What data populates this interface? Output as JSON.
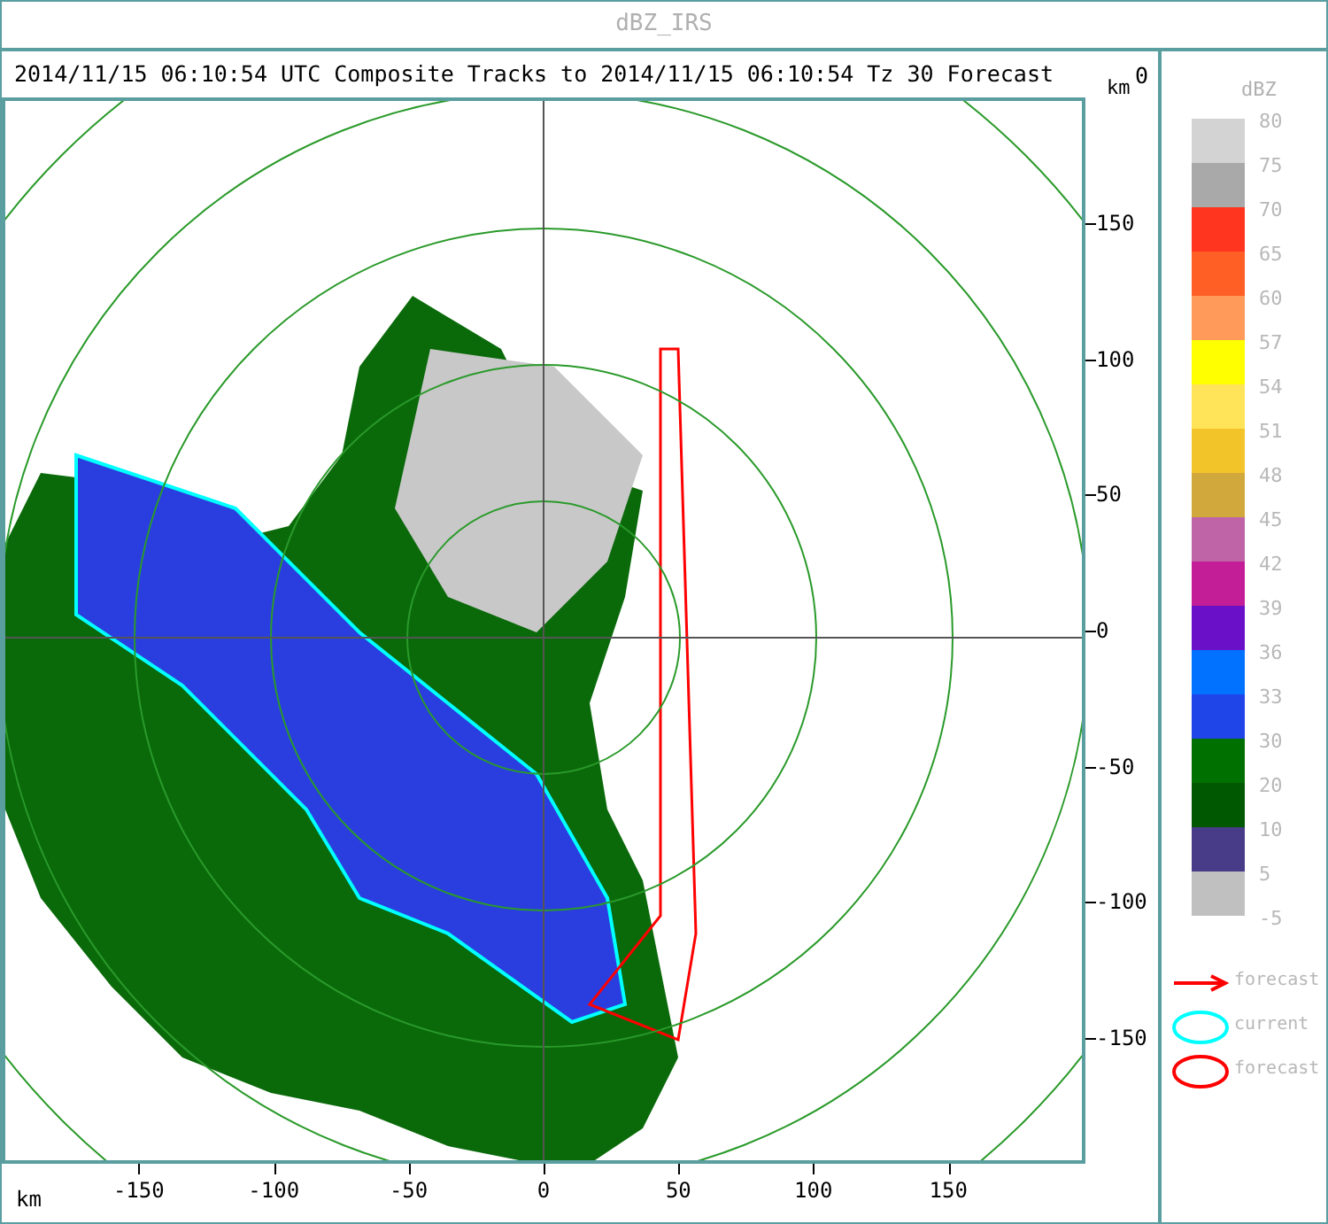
{
  "window": {
    "title": "dBZ_IRS"
  },
  "header": {
    "text": "2014/11/15 06:10:54 UTC Composite Tracks to 2014/11/15 06:10:54 Tz 30 Forecast",
    "unit": "km",
    "cut_text": "0"
  },
  "x_axis": {
    "unit": "km",
    "ticks": [
      "-150",
      "-100",
      "-50",
      "0",
      "50",
      "100",
      "150"
    ]
  },
  "y_axis": {
    "ticks": [
      "150",
      "100",
      "50",
      "0",
      "-50",
      "-100",
      "-150"
    ]
  },
  "legend": {
    "title": "dBZ",
    "scale_labels": [
      "80",
      "75",
      "70",
      "65",
      "60",
      "57",
      "54",
      "51",
      "48",
      "45",
      "42",
      "39",
      "36",
      "33",
      "30",
      "20",
      "10",
      "5",
      "-5"
    ],
    "swatches": [
      {
        "color": "#d3d3d3"
      },
      {
        "color": "#a9a9a9"
      },
      {
        "color": "#ff3520"
      },
      {
        "color": "#ff5e25"
      },
      {
        "color": "#ff9a5a"
      },
      {
        "color": "#ffff00"
      },
      {
        "color": "#ffe45a"
      },
      {
        "color": "#f3c32a"
      },
      {
        "color": "#d0a83c"
      },
      {
        "color": "#c064a8"
      },
      {
        "color": "#c31e98"
      },
      {
        "color": "#6a10c8"
      },
      {
        "color": "#0072ff"
      },
      {
        "color": "#1f45e8"
      },
      {
        "color": "#007000"
      },
      {
        "color": "#005800"
      },
      {
        "color": "#483b88"
      },
      {
        "color": "#c0c0c0"
      }
    ],
    "symbols": [
      {
        "kind": "arrow",
        "label": "forecast",
        "color": "#ff0000"
      },
      {
        "kind": "ellipse",
        "label": "current",
        "color": "#00ffff"
      },
      {
        "kind": "ellipse",
        "label": "forecast",
        "color": "#ff0000"
      }
    ]
  }
}
